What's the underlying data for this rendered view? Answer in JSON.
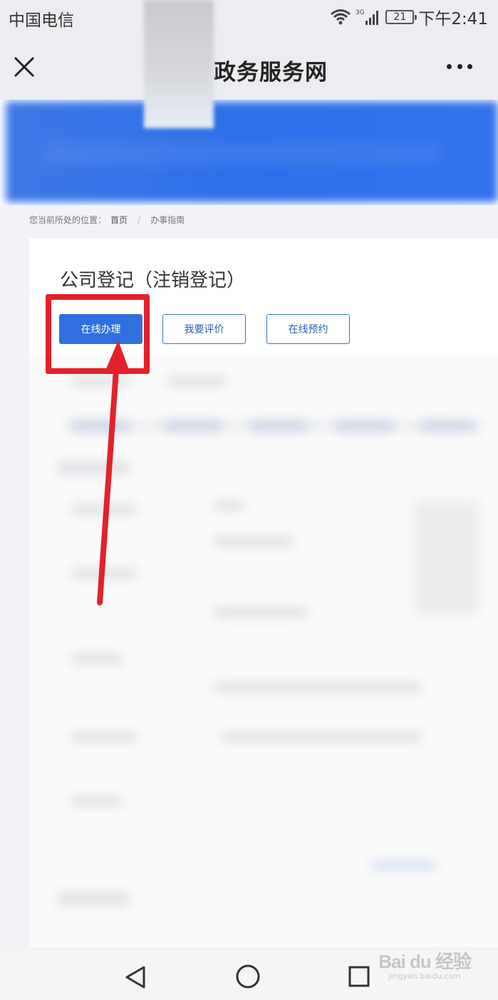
{
  "status_bar": {
    "carrier": "中国电信",
    "network": "3G",
    "battery": "21",
    "time": "下午2:41"
  },
  "title_bar": {
    "title": "政务服务网"
  },
  "breadcrumb": {
    "prefix": "您当前所处的位置：",
    "home": "首页",
    "separator": "/",
    "current": "办事指南"
  },
  "service": {
    "title": "公司登记（注销登记）",
    "buttons": {
      "online": "在线办理",
      "rate": "我要评价",
      "book": "在线预约"
    }
  },
  "watermark": {
    "logo": "Bai du 经验",
    "url": "jingyan.baidu.com"
  },
  "colors": {
    "primary": "#2f6fe0",
    "highlight": "#e4202c",
    "banner": "#2d6fe8"
  }
}
